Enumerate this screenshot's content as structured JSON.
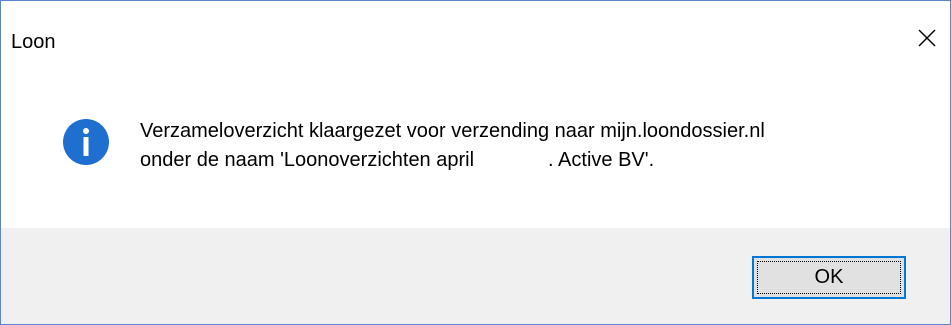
{
  "window": {
    "title": "Loon"
  },
  "icons": {
    "close": "close-icon",
    "info": "info-icon"
  },
  "message": {
    "line1": "Verzameloverzicht klaargezet voor verzending naar mijn.loondossier.nl",
    "line2_before": "onder de naam 'Loonoverzichten april",
    "line2_after": ". Active BV'."
  },
  "buttons": {
    "ok_label": "OK"
  },
  "colors": {
    "accent": "#0078d7",
    "info_icon": "#1f6fd1",
    "footer_bg": "#f0f0f0",
    "button_bg": "#e1e1e1",
    "window_border": "#5a86c9"
  }
}
